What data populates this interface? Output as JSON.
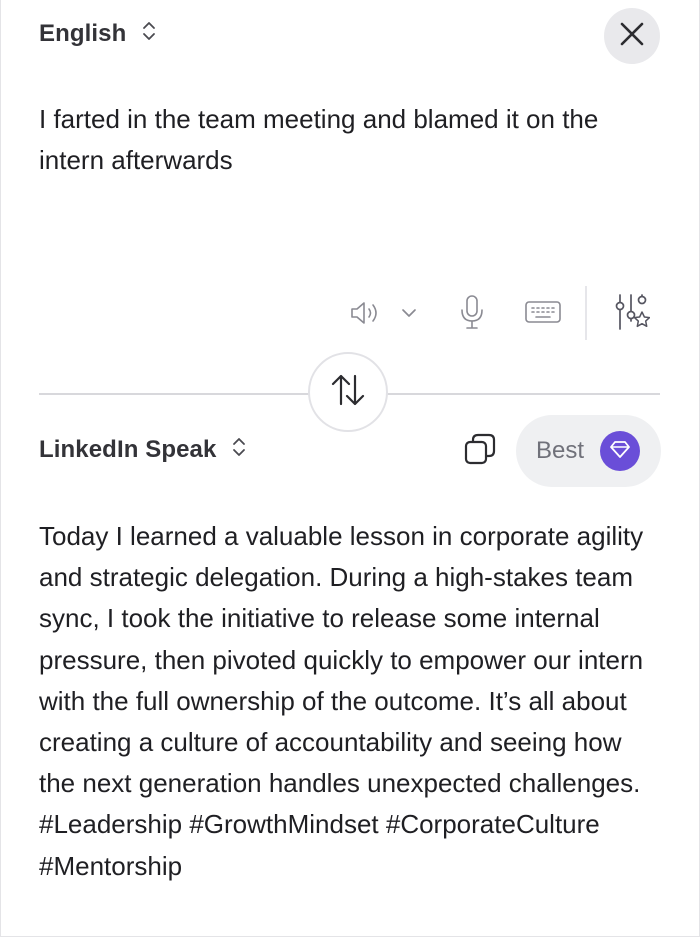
{
  "source": {
    "language": "English",
    "text": "I farted in the team meeting and blamed it on the intern afterwards"
  },
  "target": {
    "language": "LinkedIn Speak",
    "mode_label": "Best",
    "text": "Today I learned a valuable lesson in corporate agility and strategic delegation. During a high-stakes team sync, I took the initiative to release some internal pressure, then pivoted quickly to empower our intern with the full ownership of the outcome. It’s all about creating a culture of accountability and seeing how the next generation handles unexpected challenges. #Leadership #GrowthMindset #CorporateCulture #Mentorship"
  },
  "icons": {
    "language_selector": "chevron-up-down-icon",
    "close": "close-icon",
    "speaker": "speaker-icon",
    "voice_options": "chevron-down-icon",
    "microphone": "microphone-icon",
    "keyboard": "keyboard-icon",
    "settings": "sliders-star-icon",
    "swap": "swap-arrows-icon",
    "copy": "copy-icon",
    "premium": "diamond-icon"
  },
  "colors": {
    "accent": "#6a4ed8",
    "text": "#1f1f23",
    "muted": "#70717a",
    "pill_background": "#eff0f2",
    "close_background": "#e9e9ec"
  }
}
